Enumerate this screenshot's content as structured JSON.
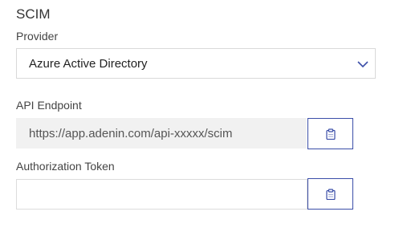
{
  "section": {
    "title": "SCIM"
  },
  "provider": {
    "label": "Provider",
    "selected": "Azure Active Directory",
    "icon": "chevron-down-icon"
  },
  "api_endpoint": {
    "label": "API Endpoint",
    "value": "https://app.adenin.com/api-xxxxx/scim",
    "copy_icon": "clipboard-icon"
  },
  "authorization_token": {
    "label": "Authorization Token",
    "value": "",
    "copy_icon": "clipboard-icon"
  },
  "colors": {
    "accent": "#3b4ea8",
    "readonly_bg": "#f1f1f1",
    "border": "#d9d9d9"
  }
}
